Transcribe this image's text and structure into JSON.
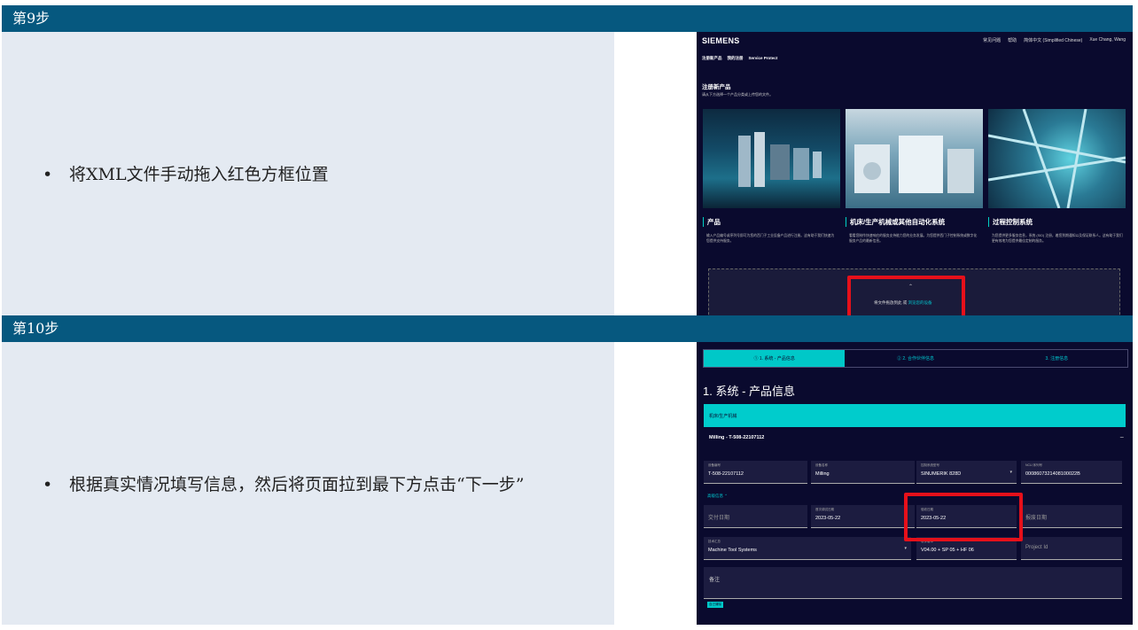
{
  "step9": {
    "header": "第9步",
    "bullet": "将XML文件手动拖入红色方框位置",
    "screenshot": {
      "brand": "SIEMENS",
      "nav": [
        "常见问题",
        "帮助",
        "简体中文 (Simplified Chinese)",
        "Xue Chang, Wang"
      ],
      "tabs": [
        "注册新产品",
        "我的注册",
        "Service Protect"
      ],
      "title": "注册新产品",
      "subtitle": "请从下方选择一个产品分类或上传您的文件。",
      "cards": [
        {
          "title": "产品",
          "desc": "输入产品编号或序列号即可为您的西门子工业设备产品进行注册。这有助于我们快速为您提供支持服务。"
        },
        {
          "title": "机床/生产机械或其他自动化系统",
          "desc": "看看您制作快速响应的服务支持能力您的业务发展。为您提供西门子控制系统或数字化服务产品的最新信息。"
        },
        {
          "title": "过程控制系统",
          "desc": "为您提供更多服务信息，系统 (SID) 注册，着您到期通知以及保证联系人。这有助于我们更有效地为您提供最佳定制的服务。"
        }
      ],
      "drop_text": "将文件拖放到此 或",
      "drop_link": "浏览您的设备"
    }
  },
  "step10": {
    "header": "第10步",
    "bullet": "根据真实情况填写信息，然后将页面拉到最下方点击“下一步”",
    "screenshot": {
      "steps": [
        "① 1. 系统 - 产品信息",
        "② 2. 合作伙伴信息",
        "3. 注册信息"
      ],
      "title": "1. 系统 - 产品信息",
      "category": "机床/生产机械",
      "machine": "Milling - T-508-22107112",
      "fields": [
        {
          "label": "设备编号",
          "value": "T-508-22107112"
        },
        {
          "label": "设备名称",
          "value": "Milling"
        },
        {
          "label": "控制系统型号",
          "value": "SINUMERIK 828D"
        },
        {
          "label": "NCU 序列号",
          "value": "0008607321408100022B"
        }
      ],
      "advanced": "高级信息 ⌃",
      "dates": [
        {
          "placeholder": "交付日期"
        },
        {
          "label": "首次调试日期",
          "value": "2023-05-22"
        },
        {
          "label": "验收日期",
          "value": "2023-05-22"
        },
        {
          "placeholder": "报废日期"
        }
      ],
      "row3": [
        {
          "label": "技术汇总",
          "value": "Machine Tool Systems"
        },
        {
          "label": "软件版本",
          "value": "V04.00 + SP 05 + HF 06"
        },
        {
          "placeholder": "Project Id"
        }
      ],
      "remark": "备注",
      "chip": "自己清除"
    }
  }
}
